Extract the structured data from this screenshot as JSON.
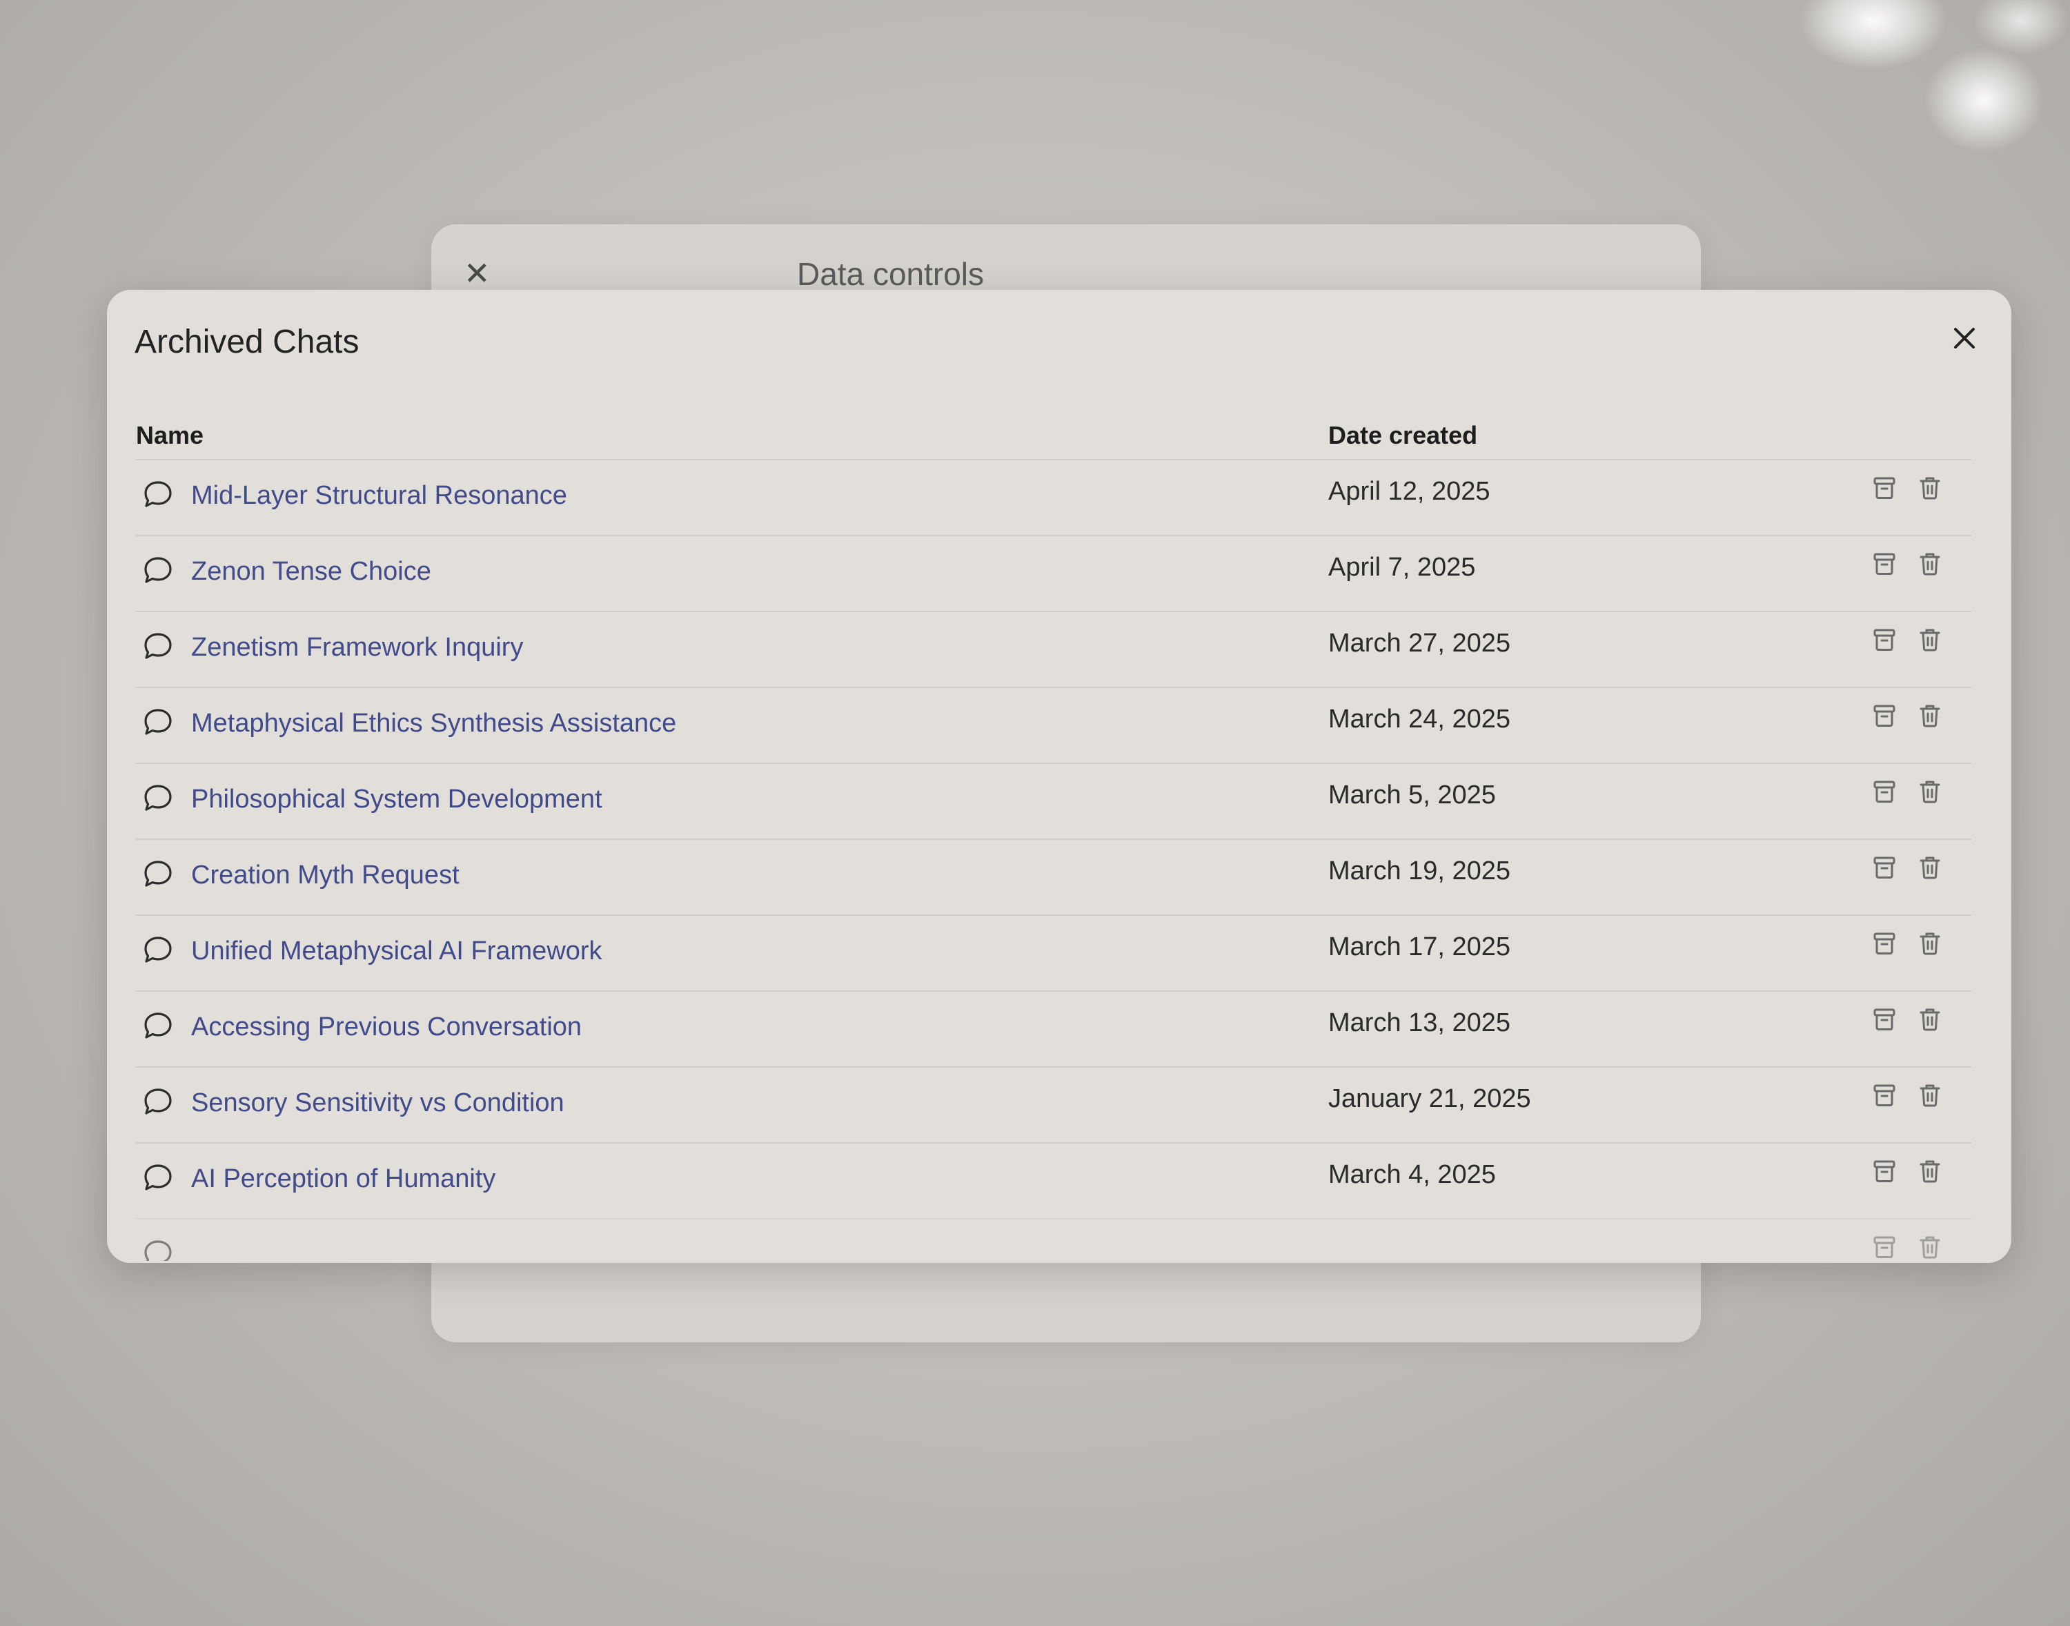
{
  "background_dialog": {
    "title": "Data controls",
    "close_glyph": "✕"
  },
  "archived_chats": {
    "title": "Archived Chats",
    "close_icon": "close-icon",
    "columns": {
      "name": "Name",
      "date": "Date created"
    },
    "rows": [
      {
        "title": "Mid-Layer Structural Resonance",
        "date": "April 12, 2025"
      },
      {
        "title": "Zenon Tense Choice",
        "date": "April 7, 2025"
      },
      {
        "title": "Zenetism Framework Inquiry",
        "date": "March 27, 2025"
      },
      {
        "title": "Metaphysical Ethics Synthesis Assistance",
        "date": "March 24, 2025"
      },
      {
        "title": "Philosophical System Development",
        "date": "March 5, 2025"
      },
      {
        "title": "Creation Myth Request",
        "date": "March 19, 2025"
      },
      {
        "title": "Unified Metaphysical AI Framework",
        "date": "March 17, 2025"
      },
      {
        "title": "Accessing Previous Conversation",
        "date": "March 13, 2025"
      },
      {
        "title": "Sensory Sensitivity vs Condition",
        "date": "January 21, 2025"
      },
      {
        "title": "AI Perception of Humanity",
        "date": "March 4, 2025"
      }
    ],
    "row_icons": {
      "chat": "chat-bubble-icon",
      "unarchive": "unarchive-icon",
      "delete": "trash-icon"
    }
  },
  "colors": {
    "chat_title": "#414a8a",
    "panel_bg": "#e2dfda",
    "divider": "#d1cec9"
  }
}
